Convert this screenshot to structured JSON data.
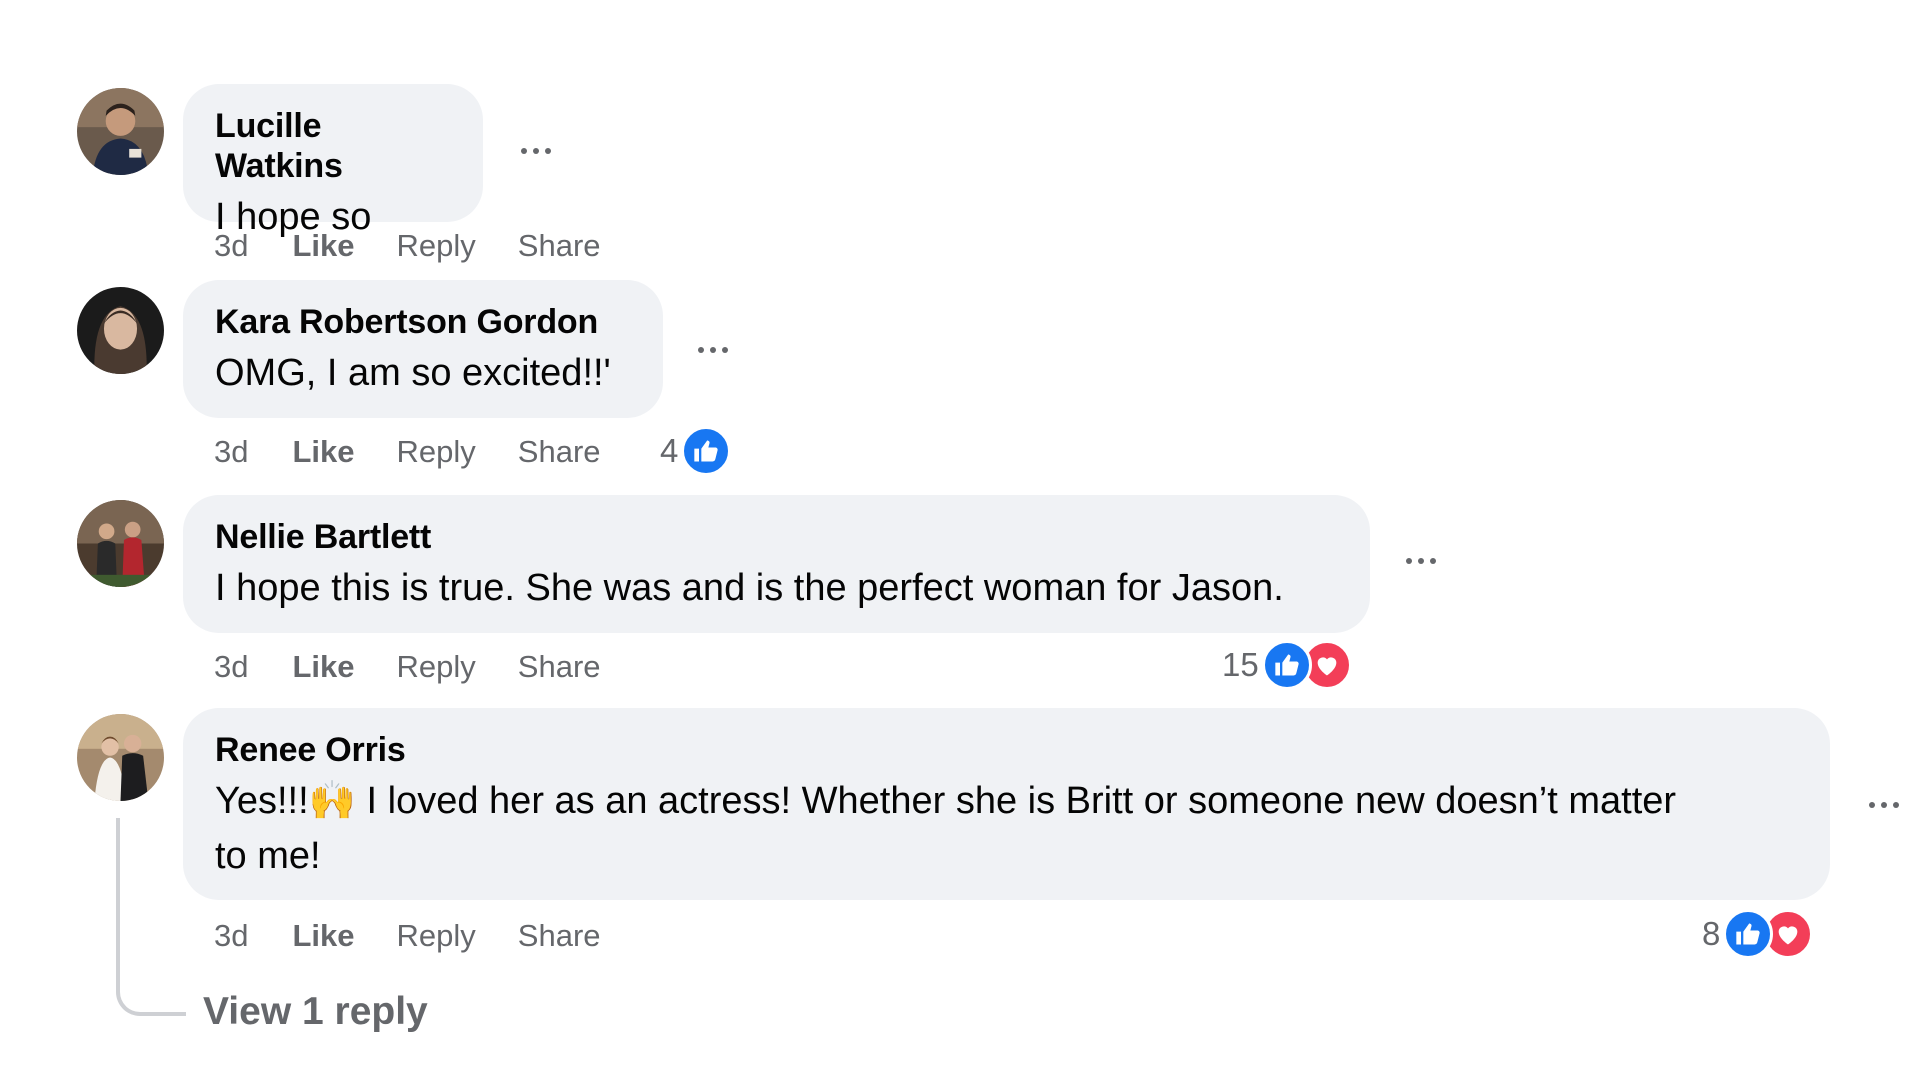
{
  "comments": [
    {
      "author": "Lucille Watkins",
      "text": "I hope so",
      "time": "3d",
      "like": "Like",
      "reply": "Reply",
      "share": "Share",
      "reaction_count": ""
    },
    {
      "author": "Kara Robertson Gordon",
      "text": "OMG, I am so excited!!'",
      "time": "3d",
      "like": "Like",
      "reply": "Reply",
      "share": "Share",
      "reaction_count": "4",
      "reactions": [
        "like"
      ]
    },
    {
      "author": "Nellie Bartlett",
      "text": "I hope this is true. She was and is the perfect woman for Jason.",
      "time": "3d",
      "like": "Like",
      "reply": "Reply",
      "share": "Share",
      "reaction_count": "15",
      "reactions": [
        "like",
        "love"
      ]
    },
    {
      "author": "Renee Orris",
      "text_line1": "Yes!!!🙌 I loved her as an actress! Whether she is Britt or someone new doesn’t matter",
      "text_line2": "to me!",
      "time": "3d",
      "like": "Like",
      "reply": "Reply",
      "share": "Share",
      "reaction_count": "8",
      "reactions": [
        "like",
        "love"
      ]
    }
  ],
  "view_replies_label": "View 1 reply",
  "icons": {
    "more": "more-options-icon",
    "like": "thumbs-up-icon",
    "love": "heart-icon"
  },
  "colors": {
    "bubble_bg": "#f0f2f5",
    "secondary_text": "#65676b",
    "like_blue": "#1877f2",
    "love_red": "#f33e58"
  }
}
